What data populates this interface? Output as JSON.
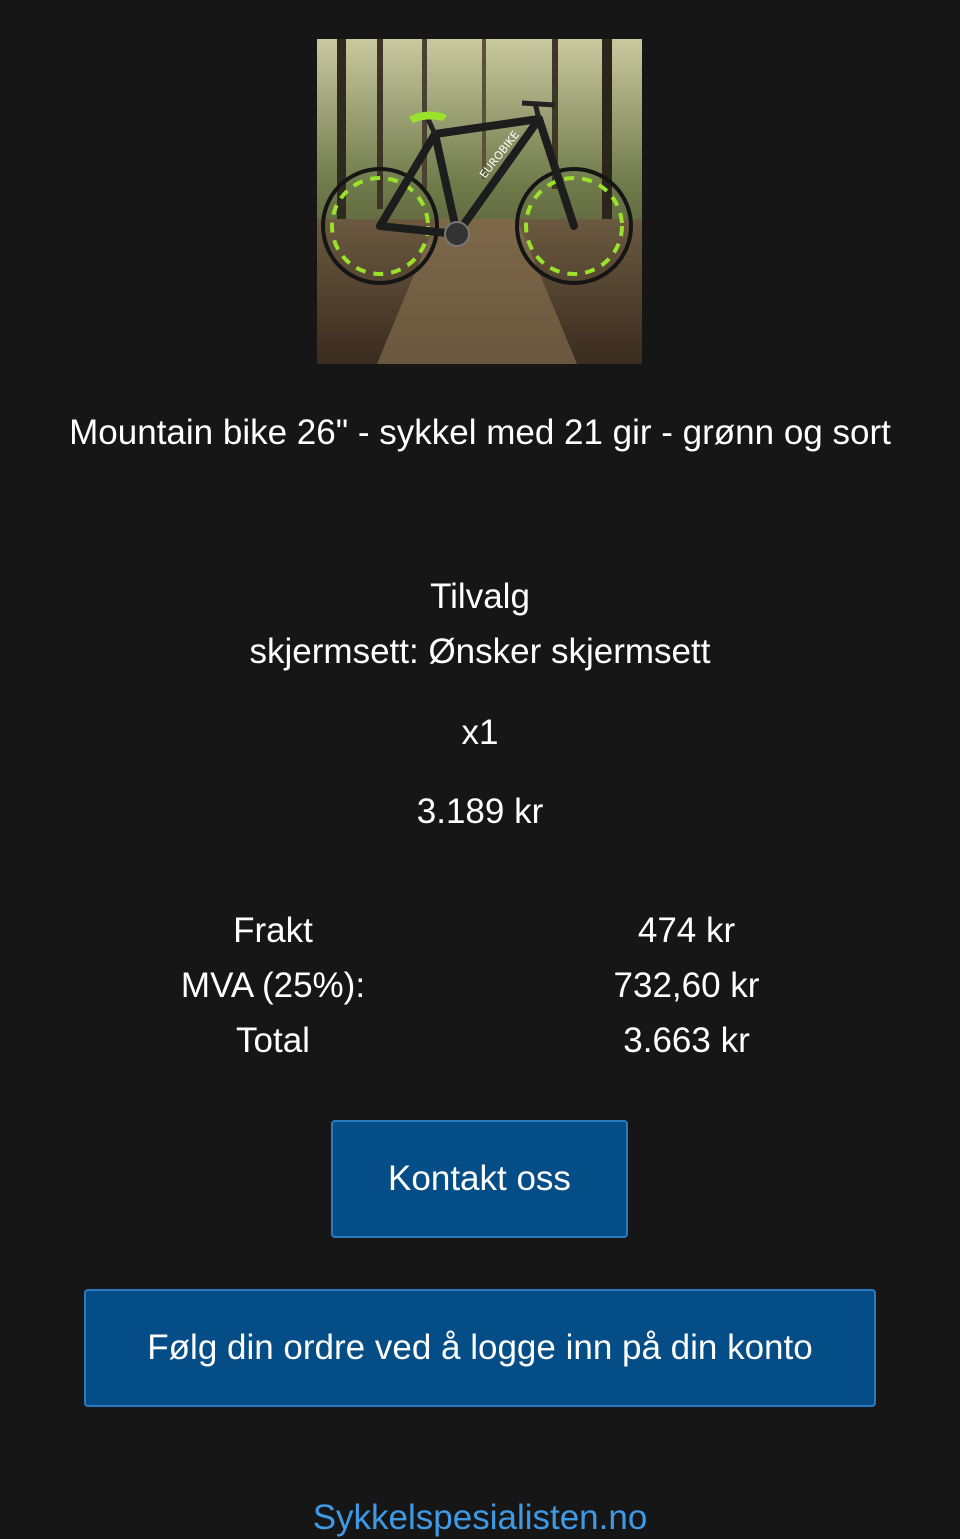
{
  "product": {
    "image_alt": "Mountain bike",
    "bike_brand_text": "EUROBIKE",
    "title": "Mountain bike 26\" - sykkel med 21 gir - grønn og sort",
    "options_heading": "Tilvalg",
    "options_value": "skjermsett: Ønsker skjermsett",
    "quantity": "x1",
    "price": "3.189 kr"
  },
  "summary": {
    "rows": [
      {
        "label": "Frakt",
        "value": "474 kr"
      },
      {
        "label": "MVA (25%):",
        "value": "732,60 kr"
      },
      {
        "label": "Total",
        "value": "3.663 kr"
      }
    ]
  },
  "buttons": {
    "contact_label": "Kontakt oss",
    "track_order_label": "Følg din ordre ved å logge inn på din konto"
  },
  "footer": {
    "link_text": "Sykkelspesialisten.no"
  },
  "colors": {
    "background": "#161616",
    "button_bg": "#044d87",
    "button_border": "#2a7ac2",
    "link": "#3f9ae6",
    "bike_accent": "#9be22a"
  }
}
